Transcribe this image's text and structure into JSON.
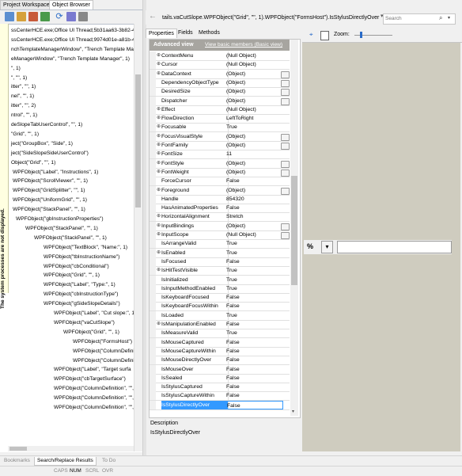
{
  "left_tabs": [
    "Project Workspace",
    "Object Browser"
  ],
  "tree_notice": "The system processes are not displayed.",
  "tree_lines": [
    "ssCenterHCE.exe;Office UI Thread;5b31aa63-3b82-4",
    "ssCenterHCE.exe;Office UI Thread;9974d01e-a81b-4",
    "nchTemplateManagerWindow\", \"Trench Template Mana",
    "eManagerWindow\", \"Trench Template Manager\", 1)",
    "\", 1)",
    "\", \"\", 1)",
    "itter\", \"\", 1)",
    "nel\", \"\", 1)",
    "itter\", \"\", 2)",
    "ntrol\", \"\", 1)",
    "deSlopeTabUserControl\", \"\", 1)",
    "\"Grid\", \"\", 1)",
    "ject(\"GroupBox\", \"Side\", 1)",
    "ject(\"SideSlopeSideUserControl\")",
    "Object(\"Grid\", \"\", 1)",
    "WPFObject(\"Label\", \"Instructions\", 1)",
    "WPFObject(\"ScrollViewer\", \"\", 1)",
    "WPFObject(\"GridSplitter\", \"\", 1)",
    "WPFObject(\"UniformGrid\", \"\", 1)",
    "WPFObject(\"StackPanel\", \"\", 1)",
    "WPFObject(\"gbInstructionProperties\")",
    "WPFObject(\"StackPanel\", \"\", 1)",
    "WPFObject(\"StackPanel\", \"\", 1)",
    "WPFObject(\"TextBlock\", \"Name:\", 1)",
    "WPFObject(\"tbInstructionName\")",
    "WPFObject(\"cbConditional\")",
    "WPFObject(\"Grid\", \"\", 1)",
    "WPFObject(\"Label\", \"Type:\", 1)",
    "WPFObject(\"cbInstructionType\")",
    "WPFObject(\"gSideSlopeDetails\")",
    "WPFObject(\"Label\", \"Cut slope:\", 1)",
    "WPFObject(\"vaCutSlope\")",
    "WPFObject(\"Grid\", \"\", 1)",
    "WPFObject(\"FormsHost\")",
    "WPFObject(\"ColumnDefini",
    "WPFObject(\"ColumnDefini",
    "WPFObject(\"Label\", \"Target surfa",
    "WPFObject(\"cbTargetSurface\")",
    "WPFObject(\"ColumnDefinition\", \"\",",
    "WPFObject(\"ColumnDefinition\", \"\",",
    "WPFObject(\"ColumnDefinition\", \"\","
  ],
  "bottom_tabs": [
    "Bookmarks",
    "Search/Replace Results",
    "To Do"
  ],
  "status_items": [
    "CAPS",
    "NUM",
    "SCRL",
    "OVR"
  ],
  "nav": {
    "path": "tails.vaCutSlope.WPFObject(\"Grid\", \"\", 1).WPFObject(\"FormsHost\").IsStylusDirectlyOver",
    "search_placeholder": "Search"
  },
  "prop_tabs": [
    "Properties",
    "Fields",
    "Methods"
  ],
  "advanced": {
    "title": "Advanced view",
    "link": "View basic members (Basic view)"
  },
  "properties": [
    {
      "name": "ContextMenu",
      "value": "(Null Object)"
    },
    {
      "name": "Cursor",
      "value": "(Null Object)"
    },
    {
      "name": "DataContext",
      "value": "(Object)"
    },
    {
      "name": "DependencyObjectType",
      "value": "(Object)"
    },
    {
      "name": "DesiredSize",
      "value": "(Object)"
    },
    {
      "name": "Dispatcher",
      "value": "(Object)"
    },
    {
      "name": "Effect",
      "value": "(Null Object)"
    },
    {
      "name": "FlowDirection",
      "value": "LeftToRight"
    },
    {
      "name": "Focusable",
      "value": "True"
    },
    {
      "name": "FocusVisualStyle",
      "value": "(Object)"
    },
    {
      "name": "FontFamily",
      "value": "(Object)"
    },
    {
      "name": "FontSize",
      "value": "11"
    },
    {
      "name": "FontStyle",
      "value": "(Object)"
    },
    {
      "name": "FontWeight",
      "value": "(Object)"
    },
    {
      "name": "ForceCursor",
      "value": "False"
    },
    {
      "name": "Foreground",
      "value": "(Object)"
    },
    {
      "name": "Handle",
      "value": "854320"
    },
    {
      "name": "HasAnimatedProperties",
      "value": "False"
    },
    {
      "name": "HorizontalAlignment",
      "value": "Stretch"
    },
    {
      "name": "InputBindings",
      "value": "(Object)"
    },
    {
      "name": "InputScope",
      "value": "(Null Object)"
    },
    {
      "name": "IsArrangeValid",
      "value": "True"
    },
    {
      "name": "IsEnabled",
      "value": "True"
    },
    {
      "name": "IsFocused",
      "value": "False"
    },
    {
      "name": "IsHitTestVisible",
      "value": "True"
    },
    {
      "name": "IsInitialized",
      "value": "True"
    },
    {
      "name": "IsInputMethodEnabled",
      "value": "True"
    },
    {
      "name": "IsKeyboardFocused",
      "value": "False"
    },
    {
      "name": "IsKeyboardFocusWithin",
      "value": "False"
    },
    {
      "name": "IsLoaded",
      "value": "True"
    },
    {
      "name": "IsManipulationEnabled",
      "value": "False"
    },
    {
      "name": "IsMeasureValid",
      "value": "True"
    },
    {
      "name": "IsMouseCaptured",
      "value": "False"
    },
    {
      "name": "IsMouseCaptureWithin",
      "value": "False"
    },
    {
      "name": "IsMouseDirectlyOver",
      "value": "False"
    },
    {
      "name": "IsMouseOver",
      "value": "False"
    },
    {
      "name": "IsSealed",
      "value": "False"
    },
    {
      "name": "IsStylusCaptured",
      "value": "False"
    },
    {
      "name": "IsStylusCaptureWithin",
      "value": "False"
    },
    {
      "name": "IsStylusDirectlyOver",
      "value": "False"
    }
  ],
  "description": {
    "title": "Description",
    "text": "IsStylusDirectlyOver"
  },
  "preview": {
    "zoom_label": "Zoom:",
    "percent_label": "%"
  },
  "colors": {
    "selection": "#3399ff",
    "preview_bg": "#cfccbf",
    "adv_header": "#a7a5a0"
  }
}
